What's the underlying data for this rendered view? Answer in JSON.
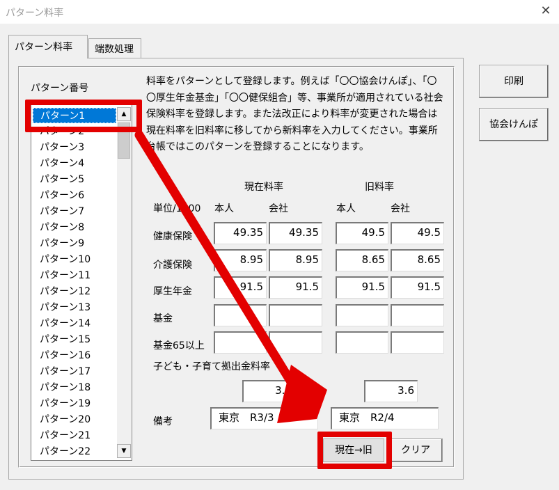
{
  "window": {
    "title": "パターン料率",
    "close_glyph": "✕"
  },
  "tabs": [
    {
      "label": "パターン料率",
      "active": true
    },
    {
      "label": "端数処理",
      "active": false
    }
  ],
  "pattern_list": {
    "label": "パターン番号",
    "selected_index": 0,
    "items": [
      "パターン1",
      "パターン2",
      "パターン3",
      "パターン4",
      "パターン5",
      "パターン6",
      "パターン7",
      "パターン8",
      "パターン9",
      "パターン10",
      "パターン11",
      "パターン12",
      "パターン13",
      "パターン14",
      "パターン15",
      "パターン16",
      "パターン17",
      "パターン18",
      "パターン19",
      "パターン20",
      "パターン21",
      "パターン22"
    ]
  },
  "description": "料率をパターンとして登録します。例えば「〇〇協会けんぽ」、「〇〇厚生年金基金」「〇〇健保組合」等、事業所が適用されている社会保険料率を登録します。また法改正により料率が変更された場合は現在料率を旧料率に移してから新料率を入力してください。事業所台帳ではこのパターンを登録することになります。",
  "rates": {
    "current_header": "現在料率",
    "old_header": "旧料率",
    "unit_label": "単位/1000",
    "employee_label": "本人",
    "company_label": "会社",
    "rows": [
      {
        "label": "健康保険",
        "cur_emp": "49.35",
        "cur_co": "49.35",
        "old_emp": "49.5",
        "old_co": "49.5"
      },
      {
        "label": "介護保険",
        "cur_emp": "8.95",
        "cur_co": "8.95",
        "old_emp": "8.65",
        "old_co": "8.65"
      },
      {
        "label": "厚生年金",
        "cur_emp": "91.5",
        "cur_co": "91.5",
        "old_emp": "91.5",
        "old_co": "91.5"
      },
      {
        "label": "基金",
        "cur_emp": "",
        "cur_co": "",
        "old_emp": "",
        "old_co": ""
      },
      {
        "label": "基金65以上",
        "cur_emp": "",
        "cur_co": "",
        "old_emp": "",
        "old_co": ""
      }
    ],
    "child_label": "子ども・子育て拠出金料率",
    "child_current": "3.6",
    "child_old": "3.6",
    "remarks_label": "備考",
    "remarks_current": "東京　R3/3",
    "remarks_old": "東京　R2/4"
  },
  "buttons": {
    "print": "印刷",
    "kyokai": "協会けんぽ",
    "move": "現在→旧",
    "clear": "クリア"
  },
  "annotation": {
    "color": "#e30000"
  }
}
